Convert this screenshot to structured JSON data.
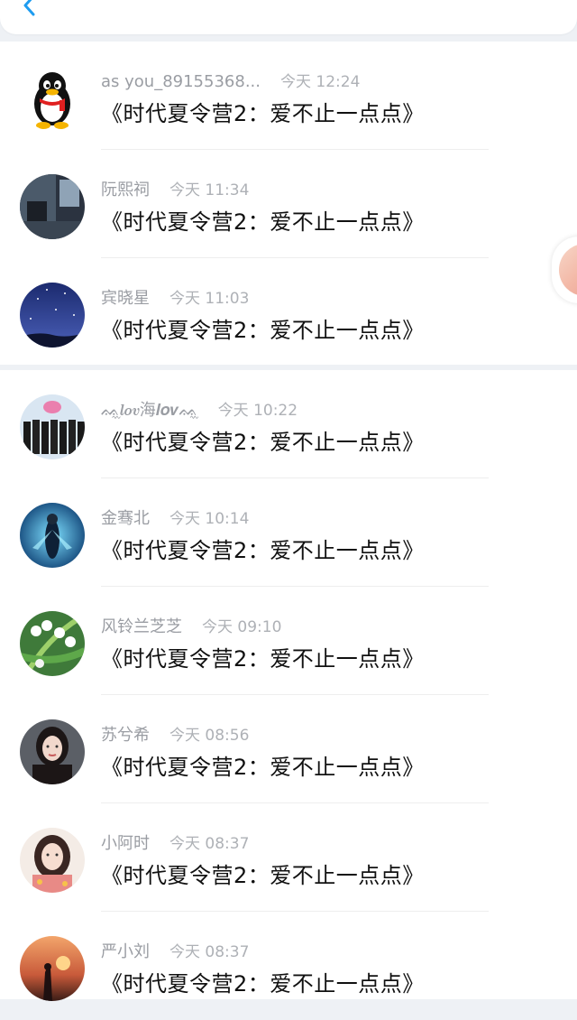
{
  "header": {
    "back_icon": "chevron-left-icon"
  },
  "messages": [
    {
      "name": "as you_89155368...",
      "time": "今天 12:24",
      "text": "《时代夏令营2：爱不止一点点》",
      "avatar": "qq-penguin"
    },
    {
      "name": "阮熙祠",
      "time": "今天 11:34",
      "text": "《时代夏令营2：爱不止一点点》",
      "avatar": "photo-dark-room"
    },
    {
      "name": "宾晓星",
      "time": "今天 11:03",
      "text": "《时代夏令营2：爱不止一点点》",
      "avatar": "photo-starry-sky"
    },
    {
      "name": "ᨐ᪶𝒍𝒐𝒗海𝒍𝒐𝒗ᨐ᪶",
      "time": "今天 10:22",
      "text": "《时代夏令营2：爱不止一点点》",
      "avatar": "photo-group"
    },
    {
      "name": "金骞北",
      "time": "今天 10:14",
      "text": "《时代夏令营2：爱不止一点点》",
      "avatar": "photo-blue-figure"
    },
    {
      "name": "风铃兰芝芝",
      "time": "今天 09:10",
      "text": "《时代夏令营2：爱不止一点点》",
      "avatar": "photo-lily-of-valley"
    },
    {
      "name": "苏兮希",
      "time": "今天 08:56",
      "text": "《时代夏令营2：爱不止一点点》",
      "avatar": "photo-girl-dark"
    },
    {
      "name": "小阿时",
      "time": "今天 08:37",
      "text": "《时代夏令营2：爱不止一点点》",
      "avatar": "photo-girl-floral"
    },
    {
      "name": "严小刘",
      "time": "今天 08:37",
      "text": "《时代夏令营2：爱不止一点点》",
      "avatar": "photo-sunset"
    }
  ],
  "colors": {
    "accent": "#1e9cf0",
    "name_text": "#9a9da3",
    "message_text": "#111111",
    "background": "#eef1f5"
  }
}
